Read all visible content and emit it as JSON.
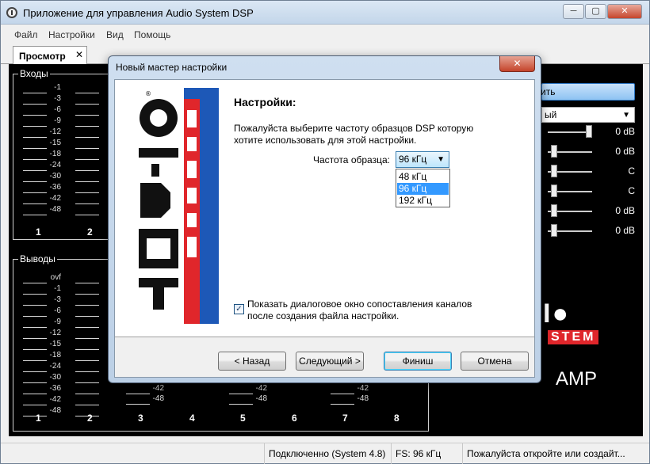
{
  "app": {
    "title": "Приложение для управления Audio System DSP",
    "controls": {
      "minimize": "─",
      "maximize": "▢",
      "close": "✕"
    }
  },
  "menu": [
    "Файл",
    "Настройки",
    "Вид",
    "Помощь"
  ],
  "tab": {
    "label": "Просмотр",
    "close": "✕"
  },
  "inputs_group": {
    "title": "Входы",
    "scale": [
      "-1",
      "-3",
      "-6",
      "-9",
      "-12",
      "-15",
      "-18",
      "-24",
      "-30",
      "-36",
      "-42",
      "-48"
    ],
    "channels": [
      "1",
      "2"
    ]
  },
  "outputs_group": {
    "title": "Выводы",
    "scale": [
      "ovf",
      "-1",
      "-3",
      "-6",
      "-9",
      "-12",
      "-15",
      "-18",
      "-24",
      "-30",
      "-36",
      "-42",
      "-48"
    ],
    "channels": [
      "1",
      "2",
      "3",
      "4",
      "5",
      "6",
      "7",
      "8"
    ],
    "visible_bottom_labels": [
      [
        "-42",
        "-48"
      ],
      [
        "-42",
        "-48"
      ],
      [
        "-42",
        "-48"
      ]
    ]
  },
  "right_panel": {
    "button_partial": "ить",
    "select_partial": "ый",
    "slider_values": [
      "0 dB",
      "0 dB",
      "C",
      "C",
      "0 dB",
      "0 dB"
    ],
    "logo_text_1": "I●",
    "logo_text_2": "STEM",
    "logo_text_3": "AMP"
  },
  "dialog": {
    "title": "Новый мастер настройки",
    "close": "✕",
    "heading": "Настройки:",
    "description": "Пожалуйста выберите частоту образцов DSP которую хотите использовать для этой настройки.",
    "rate_label": "Частота образца:",
    "rate_selected": "96 кГц",
    "rate_options": [
      "48 кГц",
      "96 кГц",
      "192 кГц"
    ],
    "rate_highlighted_index": 1,
    "checkbox_checked": true,
    "checkbox_label": "Показать диалоговое окно сопоставления каналов после создания файла настройки.",
    "buttons": {
      "back": "< Назад",
      "next": "Следующий >",
      "finish": "Финиш",
      "cancel": "Отмена"
    },
    "logo": {
      "word_1": "AUDIO",
      "word_2": "SYSTEM",
      "reg": "®",
      "red": "#e0262b",
      "blue": "#1d58b7"
    }
  },
  "status": {
    "connection": "Подключенно  (System 4.8)",
    "fs": "FS: 96 кГц",
    "hint": "Пожалуйста откройте или создайт..."
  }
}
